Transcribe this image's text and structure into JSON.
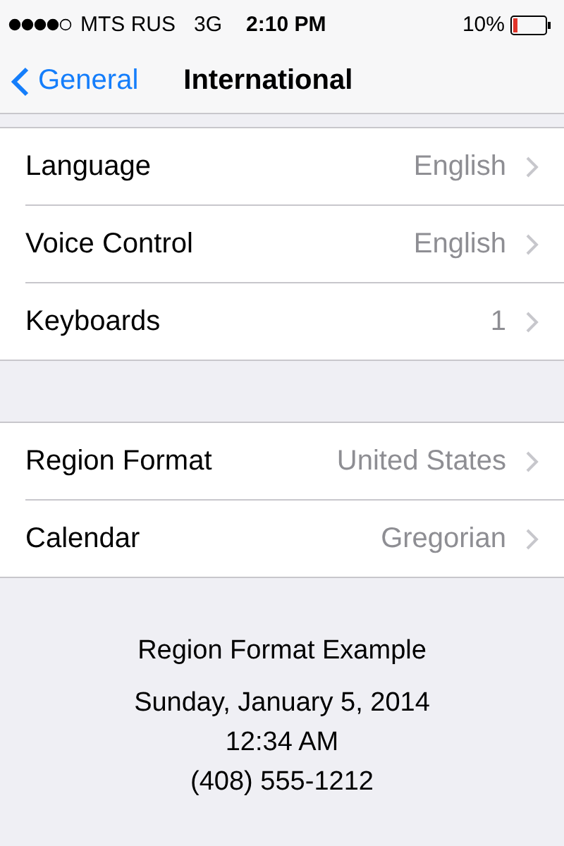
{
  "status_bar": {
    "carrier": "MTS RUS",
    "network": "3G",
    "time": "2:10 PM",
    "battery": "10%"
  },
  "nav": {
    "back": "General",
    "title": "International"
  },
  "groups": [
    {
      "rows": [
        {
          "label": "Language",
          "value": "English"
        },
        {
          "label": "Voice Control",
          "value": "English"
        },
        {
          "label": "Keyboards",
          "value": "1"
        }
      ]
    },
    {
      "rows": [
        {
          "label": "Region Format",
          "value": "United States"
        },
        {
          "label": "Calendar",
          "value": "Gregorian"
        }
      ]
    }
  ],
  "example": {
    "title": "Region Format Example",
    "lines": [
      "Sunday, January 5, 2014",
      "12:34 AM",
      "(408) 555-1212"
    ]
  }
}
